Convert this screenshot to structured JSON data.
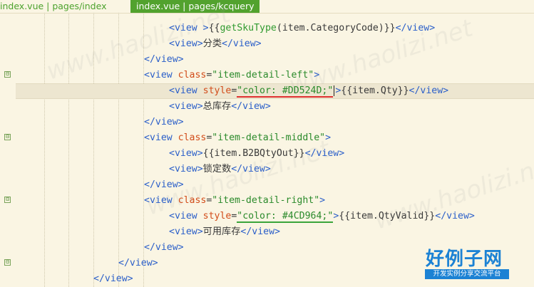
{
  "tabs": [
    {
      "label": "index.vue | pages/index",
      "active": false
    },
    {
      "label": "index.vue | pages/kcquery",
      "active": true
    }
  ],
  "code": {
    "l1": {
      "open": "<view >",
      "expr": "{{",
      "fn": "getSkuType",
      "arg": "(item.CategoryCode)}}",
      "close": "</view>"
    },
    "l2": {
      "open": "<view>",
      "text": "分类",
      "close": "</view>"
    },
    "l3": {
      "close": "</view>"
    },
    "l4": {
      "open": "<view ",
      "attr": "class",
      "eq": "=",
      "val": "\"item-detail-left\"",
      "end": ">"
    },
    "l5": {
      "open": "<view ",
      "attr": "style",
      "eq": "=",
      "val_pre": "\"color: ",
      "val_color": "#DD524D;",
      "val_post": "\"",
      "end": ">",
      "text": "{{item.Qty}}",
      "close": "</view>"
    },
    "l6": {
      "open": "<view>",
      "text": "总库存",
      "close": "</view>"
    },
    "l7": {
      "close": "</view>"
    },
    "l8": {
      "open": "<view ",
      "attr": "class",
      "eq": "=",
      "val": "\"item-detail-middle\"",
      "end": ">"
    },
    "l9": {
      "open": "<view>",
      "text": "{{item.B2BQtyOut}}",
      "close": "</view>"
    },
    "l10": {
      "open": "<view>",
      "text": "锁定数",
      "close": "</view>"
    },
    "l11": {
      "close": "</view>"
    },
    "l12": {
      "open": "<view ",
      "attr": "class",
      "eq": "=",
      "val": "\"item-detail-right\"",
      "end": ">"
    },
    "l13": {
      "open": "<view ",
      "attr": "style",
      "eq": "=",
      "val_pre": "\"color: ",
      "val_color": "#4CD964;",
      "val_post": "\"",
      "end": ">",
      "text": "{{item.QtyValid}}",
      "close": "</view>"
    },
    "l14": {
      "open": "<view>",
      "text": "可用库存",
      "close": "</view>"
    },
    "l15": {
      "close": "</view>"
    },
    "l16": {
      "close": "</view>"
    },
    "l17": {
      "close": "</view>"
    }
  },
  "fold_markers": [
    "⊟",
    "⊟",
    "⊟",
    "⊟"
  ],
  "watermark": "www.haolizi.net",
  "logo": {
    "main": "好例子网",
    "sub": "开发实例分享交流平台"
  }
}
